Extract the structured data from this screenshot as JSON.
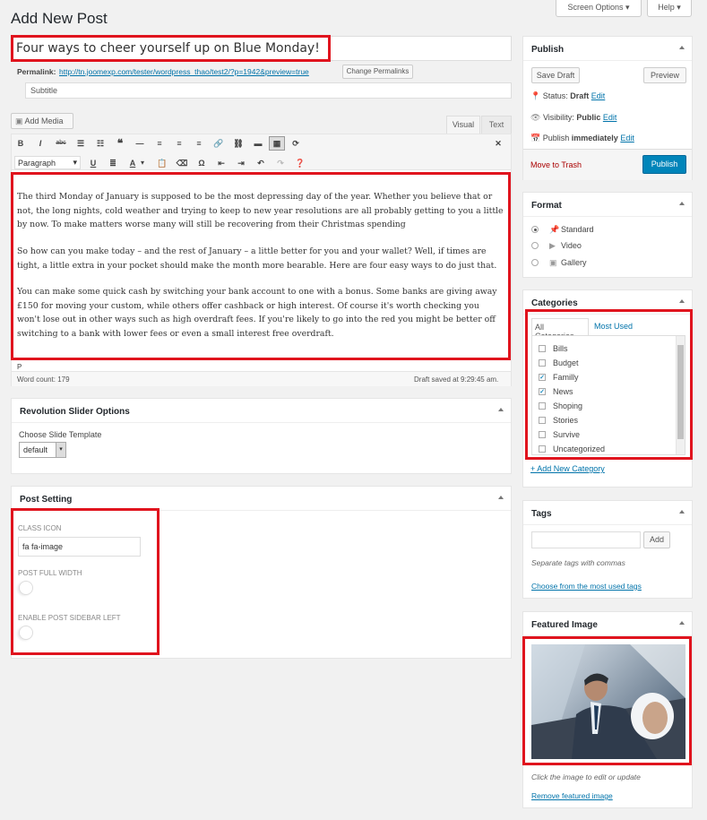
{
  "page": {
    "title": "Add New Post"
  },
  "top_buttons": {
    "screen_options": "Screen Options",
    "help": "Help"
  },
  "post": {
    "title": "Four ways to cheer yourself up on Blue Monday!",
    "permalink_label": "Permalink:",
    "permalink_url": "http://tn.joomexp.com/tester/wordpress_thao/test2/?p=1942&preview=true",
    "change_permalinks": "Change Permalinks",
    "subtitle_placeholder": "Subtitle"
  },
  "editor": {
    "add_media": "Add Media",
    "tab_visual": "Visual",
    "tab_text": "Text",
    "format_select": "Paragraph",
    "paragraphs": [
      "The third Monday of January is supposed to be the most depressing day of the year. Whether you believe that or not, the long nights, cold weather and trying to keep to new year resolutions are all probably getting to you a little by now. To make matters worse many will still be recovering from their Christmas spending",
      "So how can you make today – and the rest of January – a little better for you and your wallet? Well, if times are tight, a little extra in your pocket should make the month more bearable. Here are four easy ways to do just that.",
      "You can make some quick cash by switching your bank account to one with a bonus. Some banks are giving away £150 for moving your custom, while others offer cashback or high interest. Of course it's worth checking you won't lose out in other ways such as high overdraft fees. If you're likely to go into the red you might be better off switching to a bank with lower fees or even a small interest free overdraft."
    ],
    "path": "P",
    "word_count": "Word count: 179",
    "draft_saved": "Draft saved at 9:29:45 am."
  },
  "revolution": {
    "title": "Revolution Slider Options",
    "label": "Choose Slide Template",
    "value": "default"
  },
  "post_setting": {
    "title": "Post Setting",
    "class_icon_label": "CLASS ICON",
    "class_icon_value": "fa fa-image",
    "full_width_label": "POST FULL WIDTH",
    "sidebar_left_label": "ENABLE POST SIDEBAR LEFT"
  },
  "publish": {
    "title": "Publish",
    "save_draft": "Save Draft",
    "preview": "Preview",
    "status_label": "Status:",
    "status_value": "Draft",
    "visibility_label": "Visibility:",
    "visibility_value": "Public",
    "publish_label": "Publish",
    "publish_value": "immediately",
    "edit": "Edit",
    "trash": "Move to Trash",
    "publish_button": "Publish"
  },
  "format": {
    "title": "Format",
    "options": [
      "Standard",
      "Video",
      "Gallery"
    ],
    "selected": "Standard"
  },
  "categories": {
    "title": "Categories",
    "tab_all": "All Categories",
    "tab_used": "Most Used",
    "items": [
      {
        "label": "Bills",
        "checked": false
      },
      {
        "label": "Budget",
        "checked": false
      },
      {
        "label": "Familly",
        "checked": true
      },
      {
        "label": "News",
        "checked": true
      },
      {
        "label": "Shoping",
        "checked": false
      },
      {
        "label": "Stories",
        "checked": false
      },
      {
        "label": "Survive",
        "checked": false
      },
      {
        "label": "Uncategorized",
        "checked": false
      }
    ],
    "add_new": "+ Add New Category"
  },
  "tags": {
    "title": "Tags",
    "add": "Add",
    "hint": "Separate tags with commas",
    "choose": "Choose from the most used tags"
  },
  "featured": {
    "title": "Featured Image",
    "hint": "Click the image to edit or update",
    "remove": "Remove featured image"
  },
  "colors": {
    "accent": "#0073aa",
    "publish_button": "#0085ba",
    "highlight": "#e0141e",
    "trash": "#a00"
  }
}
